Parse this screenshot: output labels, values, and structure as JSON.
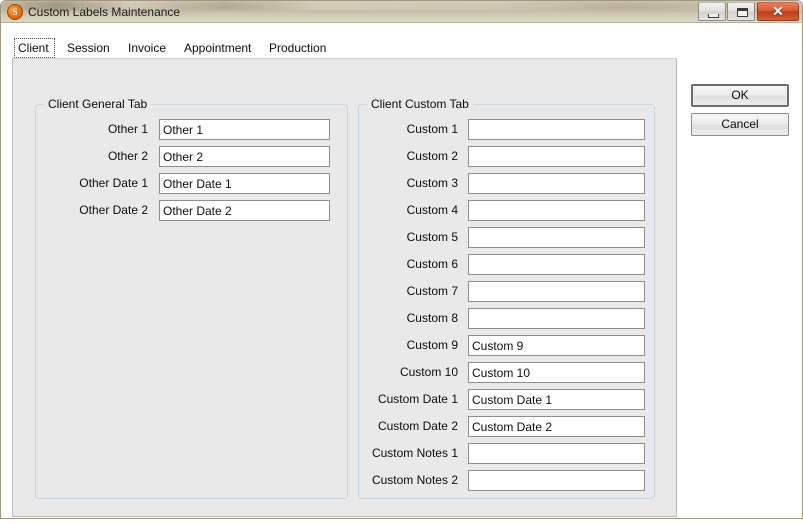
{
  "window": {
    "title": "Custom Labels Maintenance",
    "icon": "app-logo-icon",
    "icon_text": "S",
    "controls": {
      "minimize": "Minimize",
      "maximize": "Maximize",
      "close": "✕"
    }
  },
  "tabs": [
    {
      "label": "Client",
      "selected": true
    },
    {
      "label": "Session",
      "selected": false
    },
    {
      "label": "Invoice",
      "selected": false
    },
    {
      "label": "Appointment",
      "selected": false
    },
    {
      "label": "Production",
      "selected": false
    }
  ],
  "groups": {
    "general": {
      "title": "Client General Tab",
      "fields": [
        {
          "label": "Other 1",
          "value": "Other 1"
        },
        {
          "label": "Other 2",
          "value": "Other 2"
        },
        {
          "label": "Other Date 1",
          "value": "Other Date 1"
        },
        {
          "label": "Other Date 2",
          "value": "Other Date 2"
        }
      ]
    },
    "custom": {
      "title": "Client Custom Tab",
      "fields": [
        {
          "label": "Custom 1",
          "value": ""
        },
        {
          "label": "Custom 2",
          "value": ""
        },
        {
          "label": "Custom 3",
          "value": ""
        },
        {
          "label": "Custom 4",
          "value": ""
        },
        {
          "label": "Custom 5",
          "value": ""
        },
        {
          "label": "Custom 6",
          "value": ""
        },
        {
          "label": "Custom 7",
          "value": ""
        },
        {
          "label": "Custom 8",
          "value": ""
        },
        {
          "label": "Custom 9",
          "value": "Custom 9"
        },
        {
          "label": "Custom 10",
          "value": "Custom 10"
        },
        {
          "label": "Custom Date 1",
          "value": "Custom Date 1"
        },
        {
          "label": "Custom Date 2",
          "value": "Custom Date 2"
        },
        {
          "label": "Custom Notes 1",
          "value": ""
        },
        {
          "label": "Custom Notes 2",
          "value": ""
        }
      ]
    }
  },
  "buttons": {
    "ok": "OK",
    "cancel": "Cancel"
  },
  "colors": {
    "accent": "#e8761c",
    "close_button": "#bd3c16",
    "panel_background": "#e9e9e9",
    "group_border": "#c8d6e2"
  }
}
